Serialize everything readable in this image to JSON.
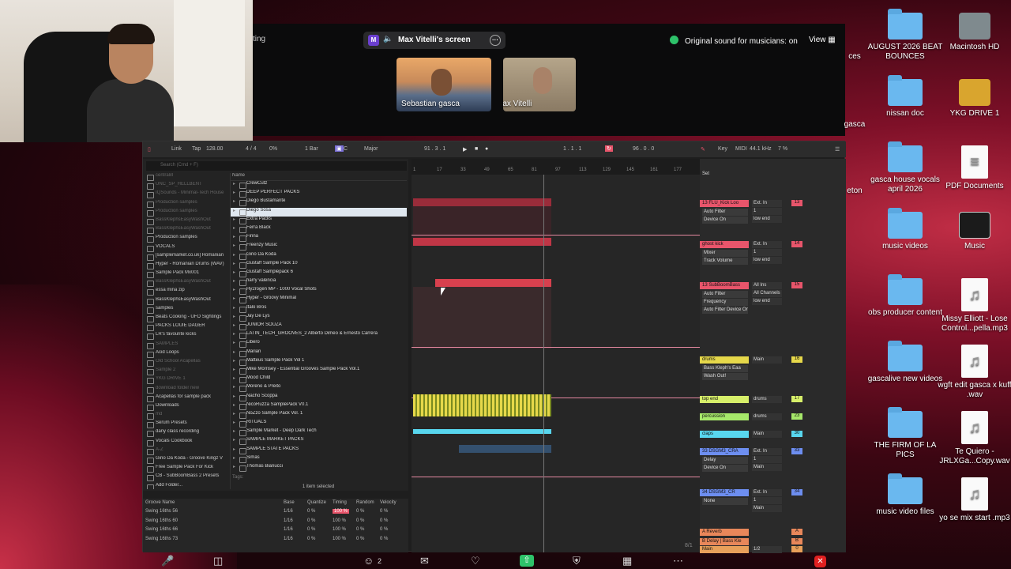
{
  "meeting": {
    "title_fragment": "ting",
    "screen_share": "Max Vitelli's screen",
    "presenter_initial": "M",
    "original_sound": "Original sound for musicians: on",
    "view_label": "View",
    "participants": [
      "Sebastian gasca",
      "Max Vitelli"
    ],
    "participant_count": "2"
  },
  "desktop": {
    "icons": [
      {
        "label": "AUGUST 2026 BEAT BOUNCES",
        "kind": "folder"
      },
      {
        "label": "Macintosh HD",
        "kind": "drive-gray"
      },
      {
        "label": "nissan doc",
        "kind": "folder"
      },
      {
        "label": "YKG DRIVE 1",
        "kind": "drive-yellow"
      },
      {
        "label": "gasca house vocals april 2026",
        "kind": "folder"
      },
      {
        "label": "PDF Documents",
        "kind": "doc"
      },
      {
        "label": "music videos",
        "kind": "folder"
      },
      {
        "label": "Music",
        "kind": "dark"
      },
      {
        "label": "obs producer content",
        "kind": "folder"
      },
      {
        "label": "Missy Elliott - Lose Control...pella.mp3",
        "kind": "audio"
      },
      {
        "label": "gascalive new videos",
        "kind": "folder"
      },
      {
        "label": "wgft edit gasca x kuff .wav",
        "kind": "audio"
      },
      {
        "label": "THE FIRM OF LA PICS",
        "kind": "folder"
      },
      {
        "label": "Te Quiero - JRLXGa...Copy.wav",
        "kind": "audio"
      },
      {
        "label": "music video files",
        "kind": "folder"
      },
      {
        "label": "yo se mix start .mp3",
        "kind": "audio"
      }
    ],
    "partial_labels": [
      "ces",
      "gasca",
      "eton"
    ]
  },
  "daw": {
    "toolbar": {
      "link": "Link",
      "tap": "Tap",
      "tempo": "128.00",
      "sig": "4 / 4",
      "pct": "0%",
      "quant": "1 Bar",
      "key": "C",
      "scale": "Major",
      "pos": "91 . 3 . 1",
      "loop_start": "1 . 1 . 1",
      "loop_len": "96 . 0 . 0",
      "key_label": "Key",
      "midi": "MIDI",
      "sr": "44.1 kHz",
      "cpu": "7 %"
    },
    "search_placeholder": "Search (Cmd + F)",
    "places": [
      {
        "label": "centralill",
        "dim": true
      },
      {
        "label": "UNC_SP_HELLBENT",
        "dim": true
      },
      {
        "label": "IQSounds - Minimal-Tech House",
        "dim": true
      },
      {
        "label": "Production samples",
        "dim": true
      },
      {
        "label": "Production samples",
        "dim": true
      },
      {
        "label": "BassKlephsEasyWashOut",
        "dim": true
      },
      {
        "label": "BassKlephsEasyWashOut",
        "dim": true
      },
      {
        "label": "Production samples",
        "dim": false
      },
      {
        "label": "VOCALS",
        "dim": false
      },
      {
        "label": "[samplemarket.co.uk] Romanian",
        "dim": false
      },
      {
        "label": "Hyper - Romanian Drums (WAV)",
        "dim": false
      },
      {
        "label": "Sample Pack Mx001",
        "dim": false
      },
      {
        "label": "BassKlephsEasyWashOut",
        "dim": true
      },
      {
        "label": "essa mina zip",
        "dim": false
      },
      {
        "label": "BassKlephsEasyWashOut",
        "dim": false
      },
      {
        "label": "samples",
        "dim": false
      },
      {
        "label": "Beats Cooking - UFO Sightings",
        "dim": false
      },
      {
        "label": "PACKS LOUIE DAGER",
        "dim": false
      },
      {
        "label": "LR's favourite kicks",
        "dim": false
      },
      {
        "label": "SAMPLES",
        "dim": true
      },
      {
        "label": "Acid Loops",
        "dim": false
      },
      {
        "label": "Old School Acapellas",
        "dim": true
      },
      {
        "label": "Sample 2",
        "dim": true
      },
      {
        "label": "YKG DRIVE 1",
        "dim": true
      },
      {
        "label": "download folder new",
        "dim": true
      },
      {
        "label": "Acapellas for sample pack",
        "dim": false
      },
      {
        "label": "Downloads",
        "dim": false
      },
      {
        "label": "md",
        "dim": true
      },
      {
        "label": "Serum Presets",
        "dim": false
      },
      {
        "label": "dany class recording",
        "dim": false
      },
      {
        "label": "Vocals Cookbook",
        "dim": false
      },
      {
        "label": "A-Z",
        "dim": true
      },
      {
        "label": "Gino Da Koda - Groove Kingz V",
        "dim": false
      },
      {
        "label": "Free Sample Pack For Kick",
        "dim": false
      },
      {
        "label": "CB - SubBoomBass 2 Presets",
        "dim": false
      },
      {
        "label": "Add Folder...",
        "dim": false
      }
    ],
    "name_header": "Name",
    "items": [
      "CrewCutz",
      "DEEP PERFECT PACKS",
      "Diego Bustamante",
      "Diego Sosa",
      "Extra Packs",
      "Ferra Black",
      "Finna",
      "Freenzy Music",
      "Gino Da Koda",
      "Gustaff Sample Pack 10",
      "Gustaff Samplepack 6",
      "harry valencia",
      "Hy2rogen MP - 1000 Vocal Shots",
      "Hyper - Groovy Minimal",
      "Italo Bros",
      "Jay De Lys",
      "JUNIOR SOUZA",
      "LATIN_TECH_GROOVES_2 Alberto Dimeo & Ernesto Carrera",
      "Libero",
      "Marian",
      "Matteus Sample Pack Vol 1",
      "Mike Morrisey - Essential Grooves Sample Pack Vol.1",
      "Mood Child",
      "Moreno & Preito",
      "Nacho Scoppa",
      "NicoRuzza SamplePack V0.1",
      "NoZzo Sample Pack Vol. 1",
      "RITUALS",
      "Sample Market - Deep Dark Tech",
      "SAMPLE MARKET PACKS",
      "SAMPLE STATE PACKS",
      "Simas",
      "Thomas Bianucci"
    ],
    "selected_index": 3,
    "tags_label": "Tags:",
    "selection_info": "1 item selected",
    "groove": {
      "headers": [
        "Groove Name",
        "Base",
        "Quantize",
        "Timing",
        "Random",
        "Velocity"
      ],
      "rows": [
        [
          "Swing 16ths 56",
          "1/16",
          "0 %",
          "100 %",
          "0 %",
          "0 %"
        ],
        [
          "Swing 16ths 60",
          "1/16",
          "0 %",
          "100 %",
          "0 %",
          "0 %"
        ],
        [
          "Swing 16ths 66",
          "1/16",
          "0 %",
          "100 %",
          "0 %",
          "0 %"
        ],
        [
          "Swing 16ths 73",
          "1/16",
          "0 %",
          "100 %",
          "0 %",
          "0 %"
        ]
      ]
    },
    "ruler": [
      "1",
      "17",
      "33",
      "49",
      "65",
      "81",
      "97",
      "113",
      "129",
      "145",
      "161",
      "177"
    ],
    "set_label": "Set",
    "tracks": [
      {
        "name": "13 FLU_Kick Loo",
        "color": "#e8556b",
        "devices": [
          "Auto Filter",
          "Device On"
        ],
        "io": [
          "Ext. In",
          "1",
          "low end"
        ],
        "num": "13"
      },
      {
        "name": "ghost kick",
        "color": "#e8556b",
        "devices": [
          "Mixer",
          "Track Volume"
        ],
        "io": [
          "Ext. In",
          "1",
          "low end"
        ],
        "num": "14"
      },
      {
        "name": "13 SubBoomBass",
        "color": "#e8556b",
        "devices": [
          "Auto Filter",
          "Frequency",
          "Auto Filter Device On"
        ],
        "io": [
          "All Ins",
          "All Channels",
          "low end"
        ],
        "num": "15"
      },
      {
        "name": "drums",
        "color": "#e6d84a",
        "devices": [
          "Bass Kleph's Eaa",
          "Wash Out!"
        ],
        "io": [
          "Main"
        ],
        "num": "16"
      },
      {
        "name": "top end",
        "color": "#d7ef6a",
        "devices": [],
        "io": [
          "drums"
        ],
        "num": "17"
      },
      {
        "name": "percussion",
        "color": "#a6e86a",
        "devices": [],
        "io": [
          "drums"
        ],
        "num": "23"
      },
      {
        "name": "claps",
        "color": "#58d6ee",
        "devices": [],
        "io": [
          "Main"
        ],
        "num": "30"
      },
      {
        "name": "33 DSGM3_CRA",
        "color": "#6d8ef0",
        "devices": [
          "Delay",
          "Device On"
        ],
        "io": [
          "Ext. In",
          "1",
          "Main"
        ],
        "num": "33"
      },
      {
        "name": "34 DSGM3_CR",
        "color": "#6d8ef0",
        "devices": [
          "None"
        ],
        "io": [
          "Ext. In",
          "1",
          "Main"
        ],
        "num": "34"
      },
      {
        "name": "A Reverb",
        "color": "#e8875a",
        "devices": [],
        "io": [],
        "num": "A"
      },
      {
        "name": "B Delay | Bass Kle",
        "color": "#e8875a",
        "devices": [],
        "io": [],
        "num": "B"
      },
      {
        "name": "Main",
        "color": "#e8a05a",
        "devices": [],
        "io": [
          "1/2"
        ],
        "num": "0"
      }
    ],
    "page_indicator": "8/1"
  }
}
